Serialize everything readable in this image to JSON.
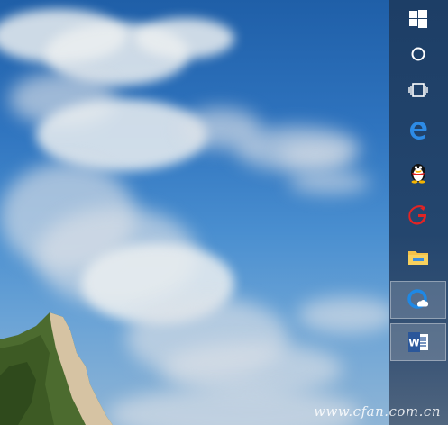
{
  "wallpaper": {
    "sky_top_color": "#1f5fa8",
    "sky_bottom_color": "#8fb5d6",
    "cliff_color": "#3b5a2a"
  },
  "taskbar": {
    "background": "#24466e",
    "items": [
      {
        "icon": "windows-start-icon",
        "active": false
      },
      {
        "icon": "cortana-circle-icon",
        "active": false
      },
      {
        "icon": "task-view-icon",
        "active": false
      },
      {
        "icon": "edge-browser-icon",
        "active": false
      },
      {
        "icon": "qq-penguin-icon",
        "active": false
      },
      {
        "icon": "red-app-icon",
        "active": false
      },
      {
        "icon": "file-explorer-icon",
        "active": false
      },
      {
        "icon": "cloud-app-icon",
        "active": true
      },
      {
        "icon": "word-icon",
        "active": true
      }
    ]
  },
  "watermark": "www.cfan.com.cn"
}
